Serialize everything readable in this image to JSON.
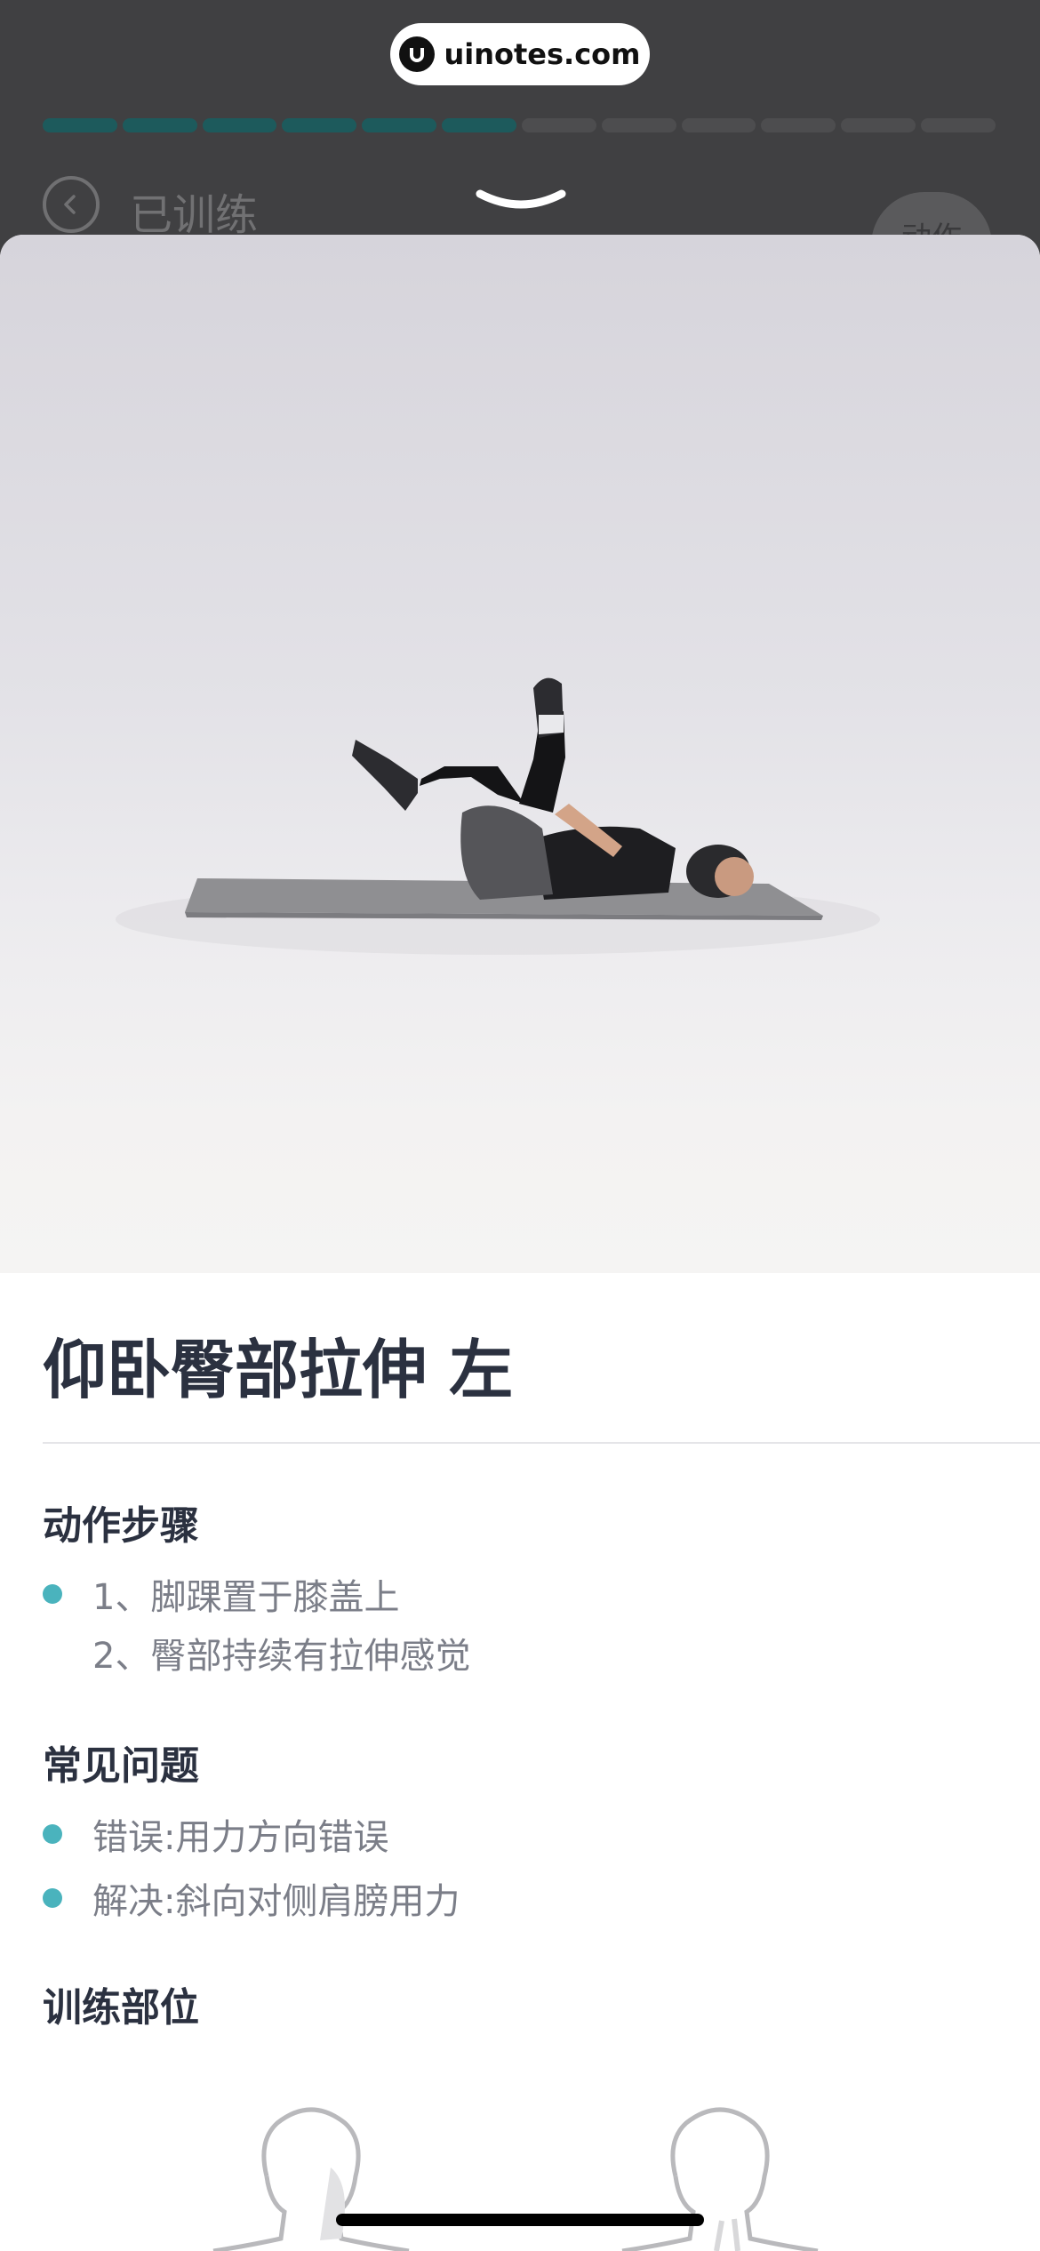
{
  "watermark": {
    "text": "uinotes.com"
  },
  "progress": {
    "done_segments": 6,
    "total_segments": 12
  },
  "header": {
    "trained_label": "已训练",
    "action_label": "动作"
  },
  "exercise": {
    "title": "仰卧臀部拉伸 左"
  },
  "sections": {
    "steps": {
      "title": "动作步骤",
      "items": [
        "1、脚踝置于膝盖上",
        "2、臀部持续有拉伸感觉"
      ]
    },
    "faq": {
      "title": "常见问题",
      "items": [
        "错误:用力方向错误",
        "解决:斜向对侧肩膀用力"
      ]
    },
    "muscles": {
      "title": "训练部位"
    }
  },
  "colors": {
    "accent": "#4ab3bd",
    "progress_done": "#1d5a5c",
    "title_text": "#2b3140",
    "body_text": "#7b7e88"
  },
  "icons": [
    "back-arrow-icon",
    "chevron-down-icon",
    "uinotes-logo-icon"
  ]
}
